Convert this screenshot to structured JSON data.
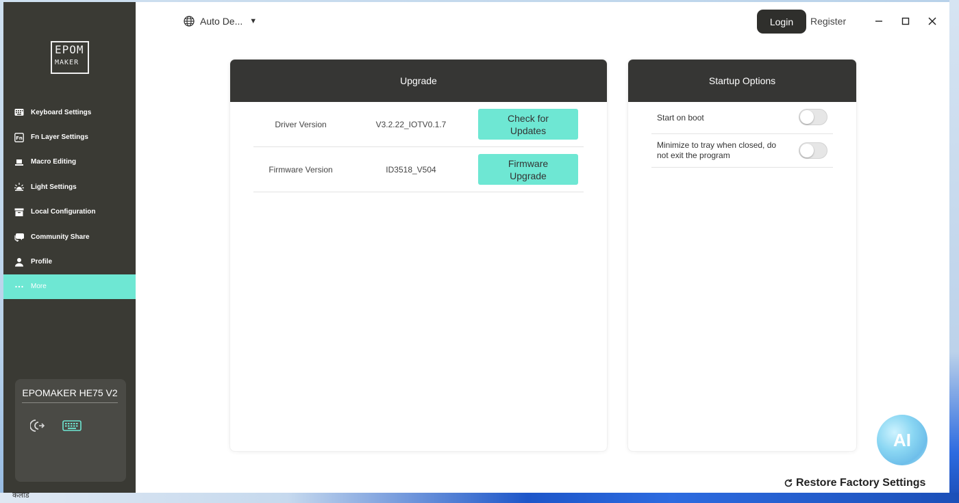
{
  "app": {
    "logo_line1": "EPOM",
    "logo_line2": "MAKER"
  },
  "sidebar": {
    "items": [
      {
        "label": "Keyboard Settings",
        "icon": "keyboard-icon"
      },
      {
        "label": "Fn Layer Settings",
        "icon": "fn-icon"
      },
      {
        "label": "Macro Editing",
        "icon": "macro-icon"
      },
      {
        "label": "Light Settings",
        "icon": "light-icon"
      },
      {
        "label": "Local Configuration",
        "icon": "archive-icon"
      },
      {
        "label": "Community Share",
        "icon": "chat-icon"
      },
      {
        "label": "Profile",
        "icon": "user-icon"
      },
      {
        "label": "More",
        "icon": "more-icon",
        "active": true
      }
    ],
    "device": {
      "name": "EPOMAKER HE75 V2"
    }
  },
  "header": {
    "language": "Auto De...",
    "login_label": "Login",
    "register_label": "Register"
  },
  "upgrade": {
    "title": "Upgrade",
    "rows": [
      {
        "label": "Driver Version",
        "value": "V3.2.22_IOTV0.1.7",
        "button": "Check for Updates"
      },
      {
        "label": "Firmware Version",
        "value": "ID3518_V504",
        "button": "Firmware Upgrade"
      }
    ]
  },
  "startup": {
    "title": "Startup Options",
    "options": [
      {
        "label": "Start on boot",
        "enabled": false
      },
      {
        "label": "Minimize to tray when closed, do not exit the program",
        "enabled": false
      }
    ]
  },
  "ai_label": "AI",
  "restore_label": "Restore Factory Settings",
  "desktop_label": "कलोड",
  "colors": {
    "sidebar_bg": "#3a3a34",
    "accent": "#6ee7d3",
    "header_dark": "#363634"
  }
}
